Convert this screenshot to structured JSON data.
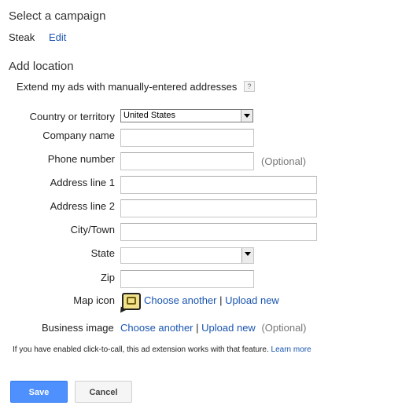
{
  "campaign": {
    "heading": "Select a campaign",
    "name": "Steak",
    "edit_label": "Edit"
  },
  "location": {
    "heading": "Add location",
    "extend_text": "Extend my ads with manually-entered addresses",
    "help_glyph": "?"
  },
  "form": {
    "country": {
      "label": "Country or territory",
      "value": "United States"
    },
    "company": {
      "label": "Company name",
      "value": ""
    },
    "phone": {
      "label": "Phone number",
      "value": "",
      "hint": "(Optional)"
    },
    "address1": {
      "label": "Address line 1",
      "value": ""
    },
    "address2": {
      "label": "Address line 2",
      "value": ""
    },
    "city": {
      "label": "City/Town",
      "value": ""
    },
    "state": {
      "label": "State",
      "value": ""
    },
    "zip": {
      "label": "Zip",
      "value": ""
    },
    "map_icon": {
      "label": "Map icon",
      "choose_label": "Choose another",
      "separator": "|",
      "upload_label": "Upload new",
      "icon": "map-pin-icon"
    },
    "business_image": {
      "label": "Business image",
      "choose_label": "Choose another",
      "separator": "|",
      "upload_label": "Upload new",
      "hint": "(Optional)"
    }
  },
  "note": {
    "text": "If you have enabled click-to-call, this ad extension works with that feature.",
    "link": "Learn more"
  },
  "buttons": {
    "save": "Save",
    "cancel": "Cancel"
  },
  "colors": {
    "link": "#1a55b0",
    "primary_button": "#4d90fe"
  }
}
